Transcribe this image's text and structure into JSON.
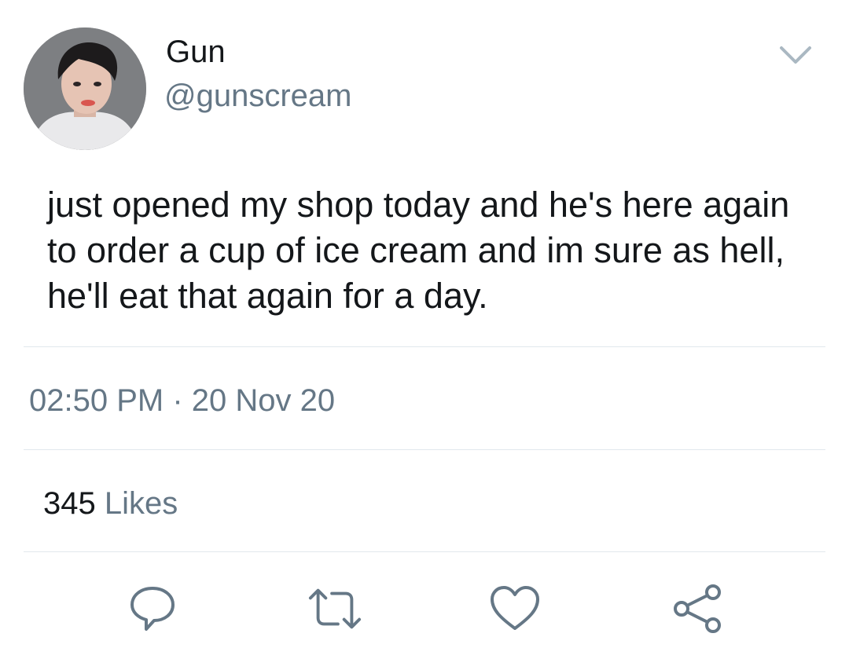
{
  "tweet": {
    "author": {
      "display_name": "Gun",
      "handle": "@gunscream",
      "avatar": "profile-photo"
    },
    "text": "just opened my shop today and he's here again to order a cup of ice cream and im sure as hell, he'll eat that again for a day.",
    "time": "02:50 PM",
    "separator": " · ",
    "date": "20 Nov 20",
    "likes_count": "345",
    "likes_label": " Likes"
  },
  "icons": {
    "menu": "chevron-down-icon",
    "reply": "reply-icon",
    "retweet": "retweet-icon",
    "like": "heart-icon",
    "share": "share-icon"
  },
  "colors": {
    "primary_text": "#14171a",
    "secondary_text": "#657786",
    "divider": "#e1e8ed",
    "icon": "#657786"
  }
}
